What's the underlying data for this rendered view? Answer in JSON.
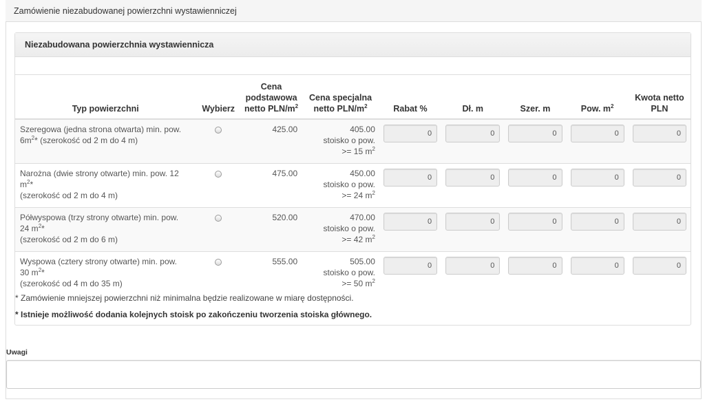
{
  "outer_title": "Zamówienie niezabudowanej powierzchni wystawienniczej",
  "inner_title": "Niezabudowana powierzchnia wystawiennicza",
  "headers": {
    "type": "Typ powierzchni",
    "select": "Wybierz",
    "base_price_l1": "Cena",
    "base_price_l2": "podstawowa",
    "base_price_l3": "netto PLN/m",
    "special_price_l1": "Cena specjalna",
    "special_price_l2": "netto PLN/m",
    "discount": "Rabat %",
    "length": "Dł. m",
    "width": "Szer. m",
    "area": "Pow. m",
    "net_amount_l1": "Kwota netto",
    "net_amount_l2": "PLN"
  },
  "rows": [
    {
      "type_l1": "Szeregowa (jedna strona otwarta) min. pow.",
      "type_l2a": "6m",
      "type_l2b": "* (szerokość od 2 m do 4 m)",
      "type_l3": "",
      "base_price": "425.00",
      "special_price": "405.00",
      "special_l2": "stoisko o pow.",
      "special_l3": ">= 15 m",
      "discount": "0",
      "length": "0",
      "width": "0",
      "area": "0",
      "net_amount": "0"
    },
    {
      "type_l1": "Narożna (dwie strony otwarte) min. pow. 12",
      "type_l2a": "m",
      "type_l2b": "*",
      "type_l3": "(szerokość od 2 m do 4 m)",
      "base_price": "475.00",
      "special_price": "450.00",
      "special_l2": "stoisko o pow.",
      "special_l3": ">= 24 m",
      "discount": "0",
      "length": "0",
      "width": "0",
      "area": "0",
      "net_amount": "0"
    },
    {
      "type_l1": "Półwyspowa (trzy strony otwarte) min. pow.",
      "type_l2a": "24 m",
      "type_l2b": "*",
      "type_l3": "(szerokość od 2 m do 6 m)",
      "base_price": "520.00",
      "special_price": "470.00",
      "special_l2": "stoisko o pow.",
      "special_l3": ">= 42 m",
      "discount": "0",
      "length": "0",
      "width": "0",
      "area": "0",
      "net_amount": "0"
    },
    {
      "type_l1": "Wyspowa (cztery strony otwarte) min. pow.",
      "type_l2a": "30 m",
      "type_l2b": "*",
      "type_l3": "(szerokość od 4 m do 35 m)",
      "base_price": "555.00",
      "special_price": "505.00",
      "special_l2": "stoisko o pow.",
      "special_l3": ">= 50 m",
      "discount": "0",
      "length": "0",
      "width": "0",
      "area": "0",
      "net_amount": "0"
    }
  ],
  "sup2": "2",
  "note1": "* Zamówienie mniejszej powierzchni niż minimalna będzie realizowane w miarę dostępności.",
  "note2": "* Istnieje możliwość dodania kolejnych stoisk po zakończeniu tworzenia stoiska głównego.",
  "remarks_label": "Uwagi",
  "remarks_value": ""
}
